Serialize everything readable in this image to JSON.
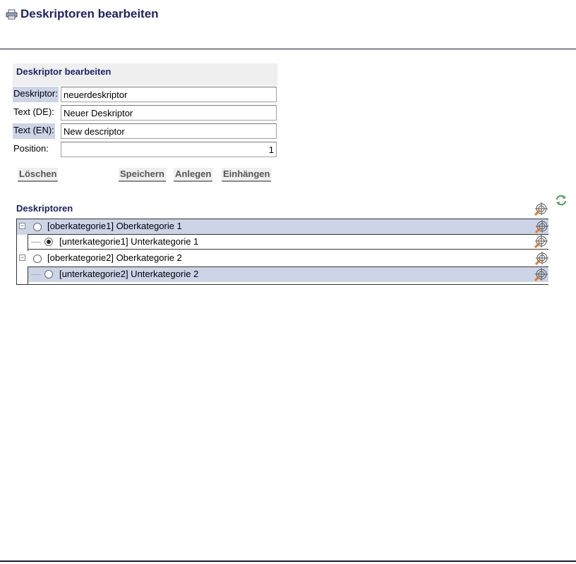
{
  "page": {
    "title": "Deskriptoren bearbeiten",
    "title_icon": "printer-icon"
  },
  "form": {
    "heading": "Deskriptor bearbeiten",
    "fields": [
      {
        "label": "Deskriptor:",
        "value": "neuerdeskriptor",
        "highlight": true
      },
      {
        "label": "Text (DE):",
        "value": "Neuer Deskriptor",
        "highlight": false
      },
      {
        "label": "Text (EN):",
        "value": "New descriptor",
        "highlight": true
      },
      {
        "label": "Position:",
        "value": "1",
        "highlight": false
      }
    ],
    "buttons": {
      "delete": "Löschen",
      "save": "Speichern",
      "create": "Anlegen",
      "attach": "Einhängen"
    }
  },
  "tree": {
    "heading": "Deskriptoren",
    "refresh_icon": "refresh-icon",
    "target_icon": "target-icon",
    "items": [
      {
        "label": "[oberkategorie1] Oberkategorie 1",
        "level": 0,
        "expanded": true,
        "selected": false,
        "highlighted": true
      },
      {
        "label": "[unterkategorie1] Unterkategorie 1",
        "level": 1,
        "selected": true,
        "highlighted": false
      },
      {
        "label": "[oberkategorie2] Oberkategorie 2",
        "level": 0,
        "expanded": true,
        "selected": false,
        "highlighted": false
      },
      {
        "label": "[unterkategorie2] Unterkategorie 2",
        "level": 1,
        "selected": false,
        "highlighted": true
      }
    ]
  },
  "colors": {
    "title": "#1d2266",
    "selection": "#ccd4e8",
    "panel": "#efefef",
    "icon_accent": "#e87722",
    "refresh": "#3aa64a"
  }
}
